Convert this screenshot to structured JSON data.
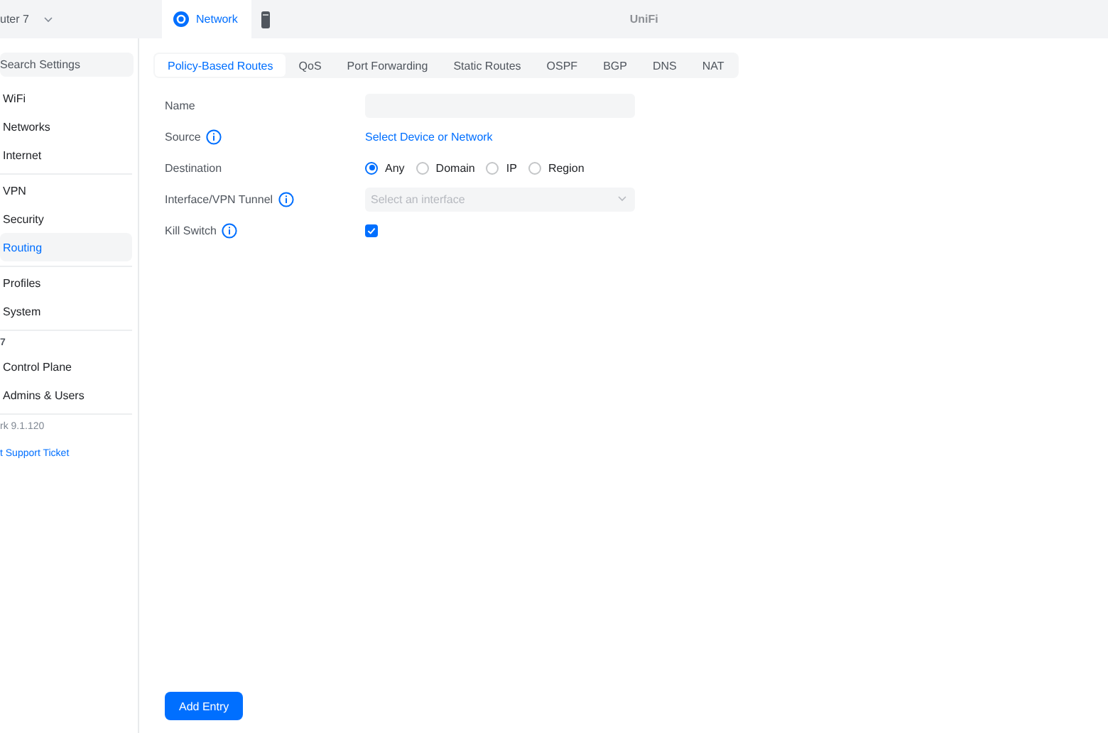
{
  "top_bar": {
    "device": "uter 7",
    "app_tab": {
      "label": "Network",
      "selected": true
    },
    "title": "UniFi"
  },
  "sidebar": {
    "search": {
      "placeholder": "Search Settings"
    },
    "groups": [
      {
        "items": [
          {
            "label": "WiFi",
            "selected": false
          },
          {
            "label": "Networks",
            "selected": false
          },
          {
            "label": "Internet",
            "selected": false
          }
        ]
      },
      {
        "items": [
          {
            "label": "VPN",
            "selected": false
          },
          {
            "label": "Security",
            "selected": false
          },
          {
            "label": "Routing",
            "selected": true
          }
        ]
      },
      {
        "items": [
          {
            "label": "Profiles",
            "selected": false
          },
          {
            "label": "System",
            "selected": false
          }
        ]
      },
      {
        "header": "7",
        "items": [
          {
            "label": "Control Plane",
            "selected": false
          },
          {
            "label": "Admins & Users",
            "selected": false
          }
        ]
      }
    ],
    "version": "rk 9.1.120",
    "support_link": "t Support Ticket"
  },
  "tabs": [
    {
      "label": "Policy-Based Routes",
      "selected": true
    },
    {
      "label": "QoS",
      "selected": false
    },
    {
      "label": "Port Forwarding",
      "selected": false
    },
    {
      "label": "Static Routes",
      "selected": false
    },
    {
      "label": "OSPF",
      "selected": false
    },
    {
      "label": "BGP",
      "selected": false
    },
    {
      "label": "DNS",
      "selected": false
    },
    {
      "label": "NAT",
      "selected": false
    }
  ],
  "form": [
    {
      "kind": "text",
      "label": "Name",
      "info": false
    },
    {
      "kind": "link",
      "label": "Source",
      "info": true,
      "link": "Select Device or Network"
    },
    {
      "kind": "radio",
      "label": "Destination",
      "info": false,
      "options": [
        {
          "label": "Any",
          "selected": true
        },
        {
          "label": "Domain",
          "selected": false
        },
        {
          "label": "IP",
          "selected": false
        },
        {
          "label": "Region",
          "selected": false
        }
      ]
    },
    {
      "kind": "select",
      "label": "Interface/VPN Tunnel",
      "info": true,
      "placeholder": "Select an interface",
      "disabled": true
    },
    {
      "kind": "checkbox",
      "label": "Kill Switch",
      "info": true,
      "checked": true
    }
  ],
  "add_button": "Add Entry"
}
